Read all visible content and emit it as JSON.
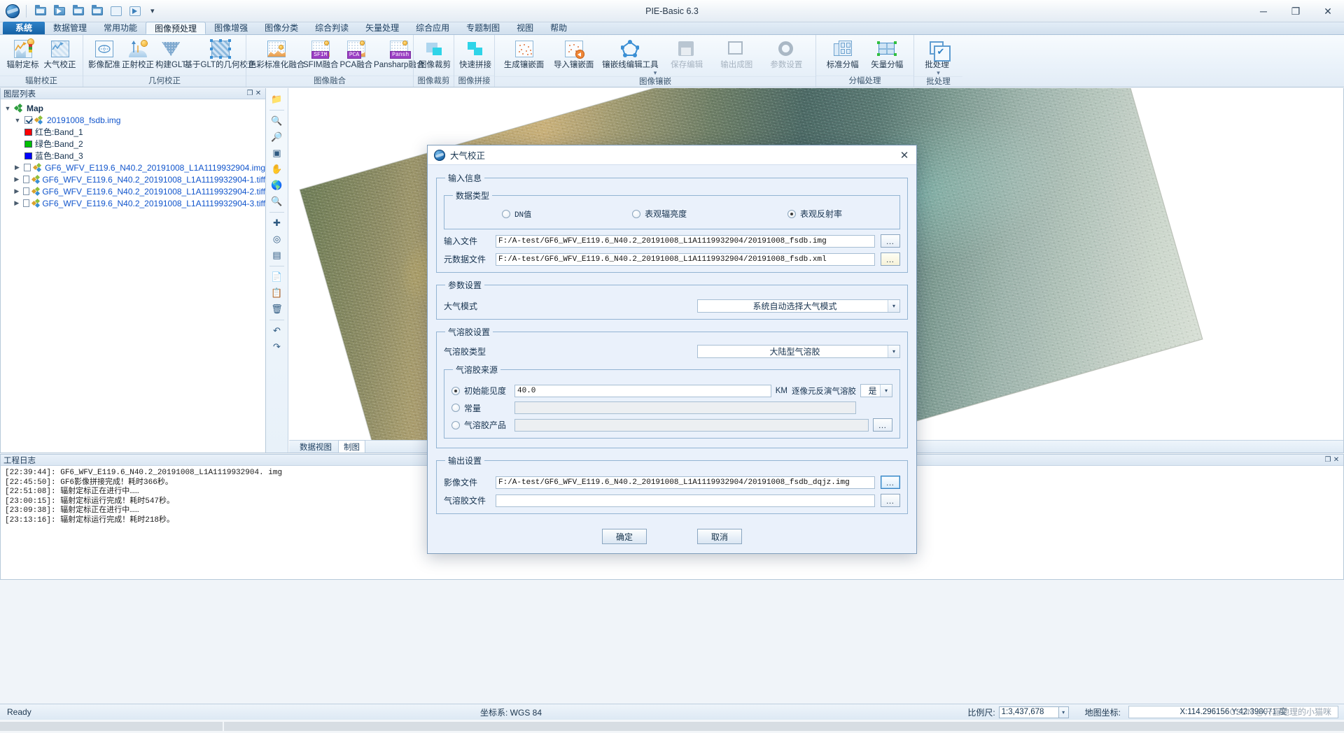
{
  "window": {
    "title": "PIE-Basic 6.3",
    "minimize": "─",
    "maximize": "❐",
    "close": "✕",
    "quick_access": [
      "new-icon",
      "open-icon",
      "save-icon",
      "save-as-icon",
      "search-icon",
      "export-icon"
    ],
    "qat_more": "▾"
  },
  "tabs": [
    {
      "label": "系统",
      "state": "system"
    },
    {
      "label": "数据管理",
      "state": "normal"
    },
    {
      "label": "常用功能",
      "state": "normal"
    },
    {
      "label": "图像预处理",
      "state": "active"
    },
    {
      "label": "图像增强",
      "state": "normal"
    },
    {
      "label": "图像分类",
      "state": "normal"
    },
    {
      "label": "综合判读",
      "state": "normal"
    },
    {
      "label": "矢量处理",
      "state": "normal"
    },
    {
      "label": "综合应用",
      "state": "normal"
    },
    {
      "label": "专题制图",
      "state": "normal"
    },
    {
      "label": "视图",
      "state": "normal"
    },
    {
      "label": "帮助",
      "state": "normal"
    }
  ],
  "ribbon": {
    "groups": [
      {
        "name": "辐射校正",
        "items": [
          {
            "label": "辐射定标",
            "icon": "radiometric-calibration-icon",
            "disabled": false
          },
          {
            "label": "大气校正",
            "icon": "atmospheric-correction-icon",
            "disabled": false
          }
        ]
      },
      {
        "name": "几何校正",
        "items": [
          {
            "label": "影像配准",
            "icon": "image-registration-icon",
            "disabled": false
          },
          {
            "label": "正射校正",
            "icon": "ortho-correction-icon",
            "disabled": false
          },
          {
            "label": "构建GLT",
            "icon": "build-glt-icon",
            "disabled": false
          },
          {
            "label": "基于GLT的几何校正",
            "icon": "glt-geometric-correction-icon",
            "disabled": false
          }
        ]
      },
      {
        "name": "图像融合",
        "items": [
          {
            "label": "色彩标准化融合",
            "icon": "color-normalize-fusion-icon",
            "disabled": false
          },
          {
            "label": "SFIM融合",
            "icon": "sfim-fusion-icon",
            "badge": "SFIM",
            "disabled": false
          },
          {
            "label": "PCA融合",
            "icon": "pca-fusion-icon",
            "badge": "PCA",
            "disabled": false
          },
          {
            "label": "Pansharp融合",
            "icon": "pansharp-fusion-icon",
            "badge": "Pansh",
            "disabled": false
          }
        ]
      },
      {
        "name": "图像裁剪",
        "items": [
          {
            "label": "图像裁剪",
            "icon": "image-crop-icon",
            "disabled": false
          }
        ]
      },
      {
        "name": "图像拼接",
        "items": [
          {
            "label": "快速拼接",
            "icon": "quick-stitch-icon",
            "disabled": false
          }
        ]
      },
      {
        "name": "图像镶嵌",
        "items": [
          {
            "label": "生成镶嵌面",
            "icon": "generate-mosaic-icon",
            "disabled": false
          },
          {
            "label": "导入镶嵌面",
            "icon": "import-mosaic-icon",
            "disabled": false
          },
          {
            "label": "镶嵌线编辑工具",
            "icon": "mosaic-line-edit-icon",
            "disabled": false
          },
          {
            "label": "保存编辑",
            "icon": "save-edit-icon",
            "disabled": true
          },
          {
            "label": "输出成图",
            "icon": "output-map-icon",
            "disabled": true
          },
          {
            "label": "参数设置",
            "icon": "parameter-settings-icon",
            "disabled": true
          }
        ]
      },
      {
        "name": "分幅处理",
        "items": [
          {
            "label": "标准分幅",
            "icon": "standard-sheet-icon",
            "disabled": false
          },
          {
            "label": "矢量分幅",
            "icon": "vector-sheet-icon",
            "disabled": false
          }
        ]
      },
      {
        "name": "批处理",
        "items": [
          {
            "label": "批处理",
            "icon": "batch-process-icon",
            "disabled": false
          }
        ]
      }
    ]
  },
  "layer_panel": {
    "title": "图层列表",
    "pin": "❐",
    "close": "✕",
    "root": "Map",
    "items": [
      {
        "label": "20191008_fsdb.img",
        "checked": true,
        "expanded": true,
        "level": 1,
        "link": true,
        "bands": [
          {
            "label": "红色:Band_1",
            "color": "#ff0000"
          },
          {
            "label": "绿色:Band_2",
            "color": "#00c000"
          },
          {
            "label": "蓝色:Band_3",
            "color": "#0000ff"
          }
        ]
      },
      {
        "label": "GF6_WFV_E119.6_N40.2_20191008_L1A1119932904.img",
        "checked": false,
        "expanded": false,
        "level": 1,
        "link": true,
        "bands": []
      },
      {
        "label": "GF6_WFV_E119.6_N40.2_20191008_L1A1119932904-1.tiff",
        "checked": false,
        "expanded": false,
        "level": 1,
        "link": true,
        "bands": []
      },
      {
        "label": "GF6_WFV_E119.6_N40.2_20191008_L1A1119932904-2.tiff",
        "checked": false,
        "expanded": false,
        "level": 1,
        "link": true,
        "bands": []
      },
      {
        "label": "GF6_WFV_E119.6_N40.2_20191008_L1A1119932904-3.tiff",
        "checked": false,
        "expanded": false,
        "level": 1,
        "link": true,
        "bands": []
      }
    ]
  },
  "map": {
    "tabs": [
      {
        "label": "数据视图",
        "active": false
      },
      {
        "label": "制图",
        "active": true
      }
    ],
    "tools": [
      "open-map-icon",
      "zoom-out-icon",
      "zoom-in-icon",
      "zoom-fit-icon",
      "pan-icon",
      "globe-icon",
      "zoom-region-icon",
      "measure-icon",
      "target-icon",
      "profile-icon",
      "copy-icon",
      "paste-icon",
      "delete-icon",
      "undo-icon",
      "redo-icon"
    ]
  },
  "log_panel": {
    "title": "工程日志",
    "pin": "❐",
    "close": "✕",
    "lines": [
      "[22:39:44]: GF6_WFV_E119.6_N40.2_20191008_L1A1119932904. img",
      "[22:45:50]: GF6影像拼接完成！耗时366秒。",
      "[22:51:08]: 辐射定标正在进行中……",
      "[23:00:15]: 辐射定标运行完成！耗时547秒。",
      "[23:09:38]: 辐射定标正在进行中……",
      "[23:13:16]: 辐射定标运行完成！耗时218秒。"
    ]
  },
  "status_bar": {
    "ready": "Ready",
    "crs_label": "坐标系: WGS 84",
    "scale_label": "比例尺:",
    "scale_value": "1:3,437,678",
    "scale_caret": "▾",
    "geo_label": "地图坐标:",
    "coords": "X:114.296156 Y:42.398071 度",
    "watermark": "CSDN @开露地理的小猫咪"
  },
  "dialog": {
    "title": "大气校正",
    "close": "✕",
    "input_group": "输入信息",
    "data_type_group": "数据类型",
    "data_types": [
      {
        "label": "DN值",
        "selected": false
      },
      {
        "label": "表观辐亮度",
        "selected": false
      },
      {
        "label": "表观反射率",
        "selected": true
      }
    ],
    "input_file_label": "输入文件",
    "input_file_value": "F:/A-test/GF6_WFV_E119.6_N40.2_20191008_L1A1119932904/20191008_fsdb.img",
    "meta_file_label": "元数据文件",
    "meta_file_value": "F:/A-test/GF6_WFV_E119.6_N40.2_20191008_L1A1119932904/20191008_fsdb.xml",
    "browse_label": "…",
    "param_group": "参数设置",
    "atmos_mode_label": "大气模式",
    "atmos_mode_value": "系统自动选择大气模式",
    "aerosol_group": "气溶胶设置",
    "aerosol_type_label": "气溶胶类型",
    "aerosol_type_value": "大陆型气溶胶",
    "aerosol_source_group": "气溶胶来源",
    "sources": [
      {
        "label": "初始能见度",
        "selected": true,
        "value": "40.0",
        "disabled": false
      },
      {
        "label": "常量",
        "selected": false,
        "value": "",
        "disabled": true
      },
      {
        "label": "气溶胶产品",
        "selected": false,
        "value": "",
        "disabled": true
      }
    ],
    "unit_label": "KM",
    "retrieve_label": "逐像元反演气溶胶",
    "retrieve_value": "是",
    "combo_caret": "▾",
    "output_group": "输出设置",
    "image_file_label": "影像文件",
    "image_file_value": "F:/A-test/GF6_WFV_E119.6_N40.2_20191008_L1A1119932904/20191008_fsdb_dqjz.img",
    "aerosol_file_label": "气溶胶文件",
    "aerosol_file_value": "",
    "ok_label": "确定",
    "cancel_label": "取消"
  }
}
